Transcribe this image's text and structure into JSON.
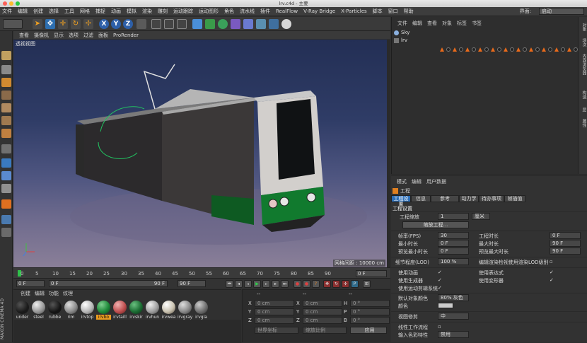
{
  "window": {
    "title": "lrv.c4d - 主要"
  },
  "menubar": {
    "items": [
      "文件",
      "编辑",
      "创建",
      "选择",
      "工具",
      "网格",
      "捕捉",
      "动画",
      "模拟",
      "渲染",
      "雕刻",
      "运动跟踪",
      "运动图形",
      "角色",
      "流水线",
      "插件",
      "RealFlow",
      "V-Ray Bridge",
      "X-Particles",
      "脚本",
      "窗口",
      "帮助"
    ],
    "layout_label": "界面:",
    "layout_value": "启动"
  },
  "toolbar": {
    "axis_x": "X",
    "axis_y": "Y",
    "axis_z": "Z"
  },
  "viewport_menu": [
    "查看",
    "摄像机",
    "显示",
    "选项",
    "过滤",
    "面板",
    "ProRender"
  ],
  "viewport": {
    "label": "透视视图",
    "grid_spacing": "网格间距 : 10000 cm"
  },
  "timeline": {
    "ticks": [
      "0",
      "5",
      "10",
      "15",
      "20",
      "25",
      "30",
      "35",
      "40",
      "45",
      "50",
      "55",
      "60",
      "65",
      "70",
      "75",
      "80",
      "85",
      "90"
    ],
    "frame_indicator": "0 F"
  },
  "anim": {
    "start": "0 F",
    "current": "0 F",
    "end": "90 F",
    "end2": "90 F"
  },
  "materials": {
    "menu": [
      "创建",
      "编辑",
      "功能",
      "纹理"
    ],
    "items": [
      {
        "label": "under",
        "color": "#1a1a1a"
      },
      {
        "label": "steel",
        "color": "#9a9a9a"
      },
      {
        "label": "rubbe",
        "color": "#141414"
      },
      {
        "label": "rim",
        "color": "#8d8d8d"
      },
      {
        "label": "irvtop",
        "color": "#b8b8b8"
      },
      {
        "label": "irvbo",
        "color": "#1f8a3a",
        "selected": true
      },
      {
        "label": "irvtaill",
        "color": "#c05050"
      },
      {
        "label": "irvskir",
        "color": "#1c6e34"
      },
      {
        "label": "irvhun",
        "color": "#a0a0a0"
      },
      {
        "label": "irvwea",
        "color": "#c9c2b0"
      },
      {
        "label": "irvgray",
        "color": "#8a8a8a"
      },
      {
        "label": "irvgla",
        "color": "#707070"
      }
    ],
    "sidebar_brand": "MAXON CINEMA 4D"
  },
  "coords": {
    "header1": "--",
    "header2": "--",
    "header3": "--",
    "rows": [
      {
        "a": "X",
        "av": "0 cm",
        "b": "X",
        "bv": "0 cm",
        "c": "H",
        "cv": "0 °"
      },
      {
        "a": "Y",
        "av": "0 cm",
        "b": "Y",
        "bv": "0 cm",
        "c": "P",
        "cv": "0 °"
      },
      {
        "a": "Z",
        "av": "0 cm",
        "b": "Z",
        "bv": "0 cm",
        "c": "B",
        "cv": "0 °"
      }
    ],
    "mode1": "世界坐标",
    "mode2": "缩放比例",
    "apply": "应用"
  },
  "objmgr": {
    "menu": [
      "文件",
      "编辑",
      "查看",
      "对象",
      "标签",
      "书签"
    ],
    "objects": [
      {
        "name": "Sky"
      },
      {
        "name": "lrv"
      }
    ]
  },
  "sidetabs": [
    "对象",
    "场次",
    "内容浏览器",
    "构造",
    "层",
    "属性"
  ],
  "attrmgr": {
    "menu": [
      "模式",
      "编辑",
      "用户数据"
    ],
    "heading": "工程",
    "tabs": [
      "工程设置",
      "信息",
      "参考",
      "动力学",
      "待办事项",
      "帧插值"
    ],
    "section": "工程设置",
    "scale_label": "工程缩放",
    "scale_value": "1",
    "scale_unit": "厘米",
    "scale_button": "缩放工程...",
    "fps_label": "帧率(FPS)",
    "fps_value": "30",
    "min_time_label": "最小时长",
    "min_time_value": "0 F",
    "preview_min_label": "预览最小时长",
    "preview_min_value": "0 F",
    "project_time_label": "工程时长",
    "project_time_value": "0 F",
    "max_time_label": "最大时长",
    "max_time_value": "90 F",
    "preview_max_label": "预览最大时长",
    "preview_max_value": "90 F",
    "lod_label": "细节程度(LOD)",
    "lod_value": "100 %",
    "render_lod_label": "编辑渲染检视使用渲染LOD级别",
    "use_anim_label": "使用动画",
    "use_expr_label": "使用表达式",
    "use_gen_label": "使用生成器",
    "use_deform_label": "使用变形器",
    "use_motion_label": "使用运动剪辑系统",
    "default_color_label": "默认对象颜色",
    "default_color_value": "80% 灰色",
    "color_label": "颜色",
    "view_clip_label": "视图修剪",
    "view_clip_value": "中",
    "linear_label": "线性工作流程",
    "input_color_label": "输入色彩特性",
    "input_color_value": "禁用"
  }
}
